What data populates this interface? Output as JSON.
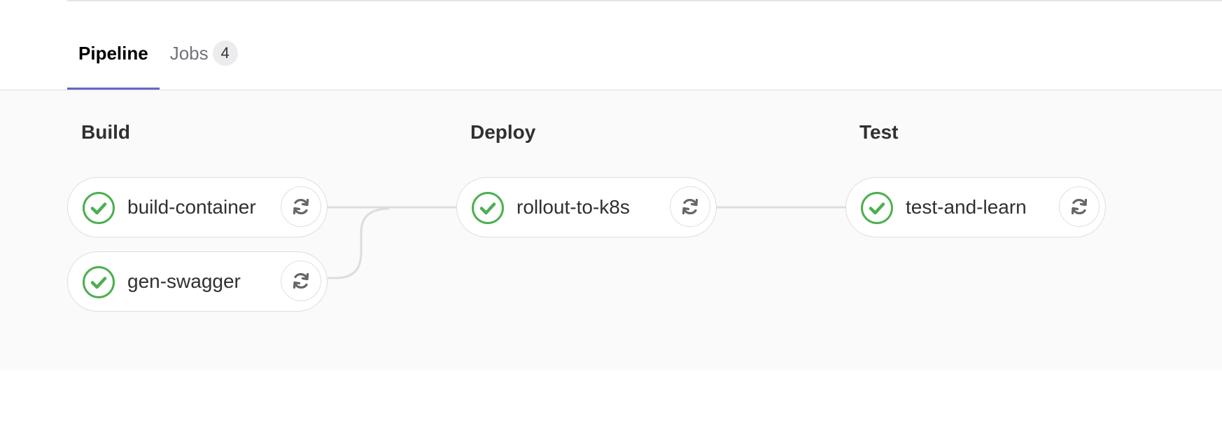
{
  "tabs": [
    {
      "label": "Pipeline",
      "active": true
    },
    {
      "label": "Jobs",
      "count": "4",
      "active": false
    }
  ],
  "stages": [
    {
      "title": "Build",
      "jobs": [
        {
          "name": "build-container",
          "status": "success",
          "status_icon": "check-circle-icon",
          "action_icon": "retry-icon"
        },
        {
          "name": "gen-swagger",
          "status": "success",
          "status_icon": "check-circle-icon",
          "action_icon": "retry-icon"
        }
      ]
    },
    {
      "title": "Deploy",
      "jobs": [
        {
          "name": "rollout-to-k8s",
          "status": "success",
          "status_icon": "check-circle-icon",
          "action_icon": "retry-icon"
        }
      ]
    },
    {
      "title": "Test",
      "jobs": [
        {
          "name": "test-and-learn",
          "status": "success",
          "status_icon": "check-circle-icon",
          "action_icon": "retry-icon"
        }
      ]
    }
  ],
  "colors": {
    "success": "#4caf50",
    "active_tab_underline": "#6666c4",
    "connector": "#dddddd"
  }
}
